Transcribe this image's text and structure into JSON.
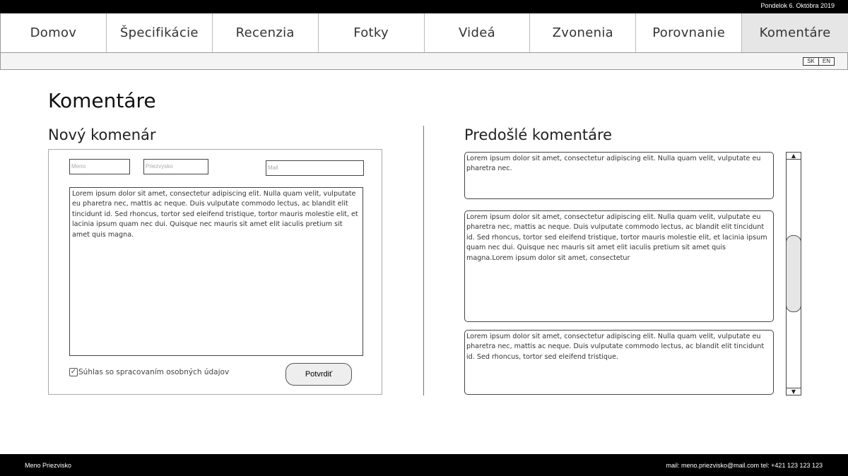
{
  "header": {
    "date": "Pondelok 6. Októbra 2019"
  },
  "nav": {
    "tabs": [
      {
        "label": "Domov"
      },
      {
        "label": "Špecifikácie"
      },
      {
        "label": "Recenzia"
      },
      {
        "label": "Fotky"
      },
      {
        "label": "Videá"
      },
      {
        "label": "Zvonenia"
      },
      {
        "label": "Porovnanie"
      },
      {
        "label": "Komentáre",
        "active": true
      }
    ]
  },
  "language": {
    "options": [
      "SK",
      "EN"
    ]
  },
  "page": {
    "title": "Komentáre"
  },
  "new_comment": {
    "title": "Nový komenár",
    "name_placeholder": "Meno",
    "surname_placeholder": "Priezvysko",
    "mail_placeholder": "Mail",
    "text": "Lorem ipsum dolor sit amet, consectetur adipiscing elit. Nulla quam velit, vulputate eu pharetra nec, mattis ac neque. Duis vulputate commodo lectus, ac blandit elit tincidunt id. Sed rhoncus, tortor sed eleifend tristique, tortor mauris molestie elit, et lacinia ipsum quam nec dui. Quisque nec mauris sit amet elit iaculis pretium sit amet quis magna.",
    "consent_label": "Súhlas so spracovaním osobných údajov",
    "consent_checked": true,
    "submit_label": "Potvrdiť"
  },
  "previous_comments": {
    "title": "Predošlé komentáre",
    "items": [
      {
        "text": "Lorem ipsum dolor sit amet, consectetur adipiscing elit. Nulla quam velit, vulputate eu pharetra nec."
      },
      {
        "text": "Lorem ipsum dolor sit amet, consectetur adipiscing elit. Nulla quam velit, vulputate eu pharetra nec, mattis ac neque. Duis vulputate commodo lectus, ac blandit elit tincidunt id. Sed rhoncus, tortor sed eleifend tristique, tortor mauris molestie elit, et lacinia ipsum quam nec dui. Quisque nec mauris sit amet elit iaculis pretium sit amet quis magna.Lorem ipsum dolor sit amet, consectetur"
      },
      {
        "text": "Lorem ipsum dolor sit amet, consectetur adipiscing elit. Nulla quam velit, vulputate eu pharetra nec, mattis ac neque. Duis vulputate commodo lectus, ac blandit elit tincidunt id. Sed rhoncus, tortor sed eleifend tristique."
      }
    ]
  },
  "footer": {
    "name": "Meno Priezvisko",
    "contact": "mail: meno.priezvisko@mail.com  tel: +421 123 123 123"
  }
}
